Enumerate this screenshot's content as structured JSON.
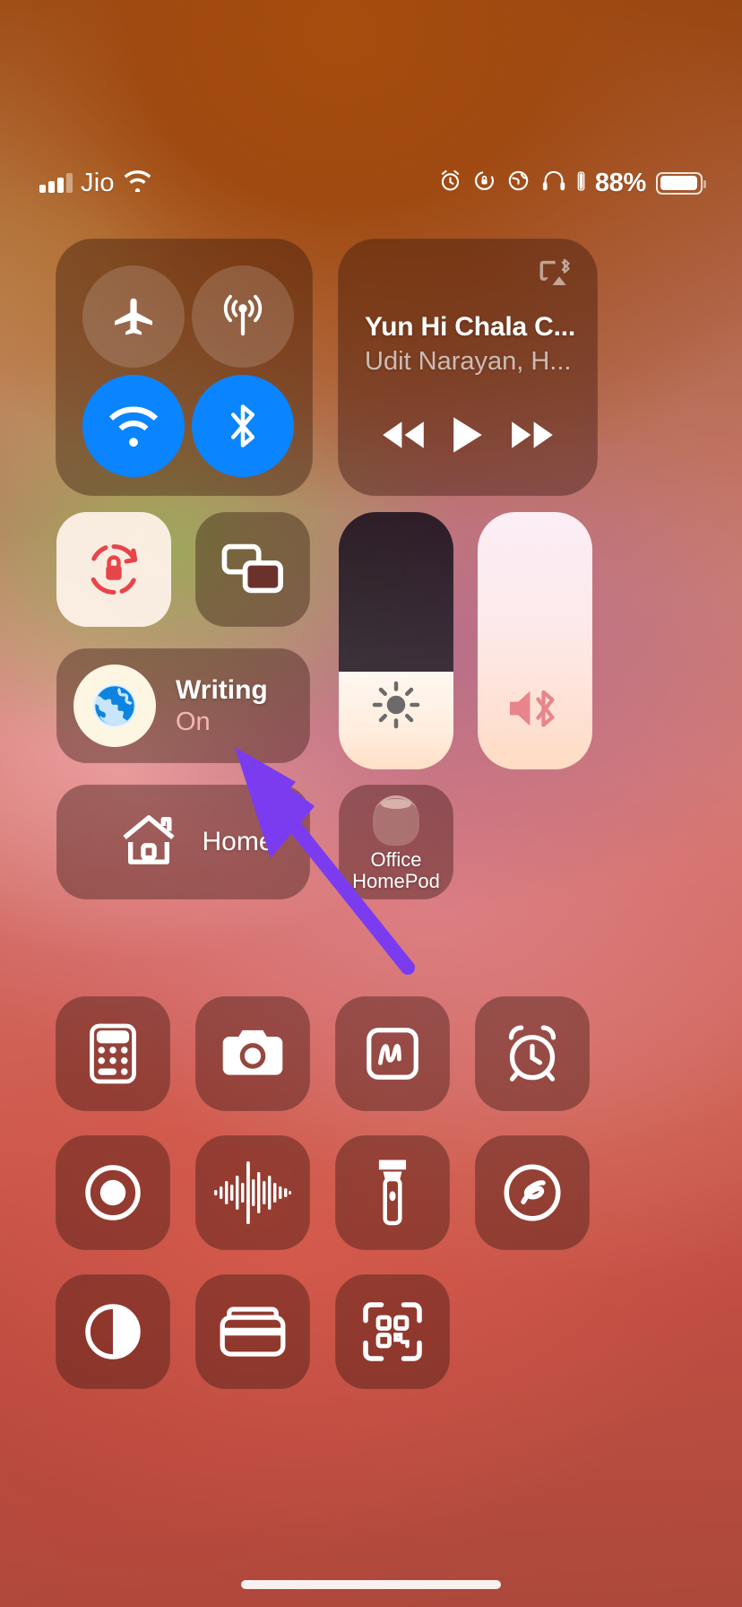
{
  "status_bar": {
    "carrier": "Jio",
    "signal_icon": "cellular-bars-icon",
    "wifi_icon": "wifi-icon",
    "indicators": [
      "alarm-icon",
      "rotation-lock-icon",
      "location-icon",
      "headphones-icon"
    ],
    "battery_percent": "88%",
    "battery_level": 88,
    "battery_icon": "battery-icon"
  },
  "control_center": {
    "connectivity": {
      "name": "connectivity-module",
      "toggles": [
        {
          "name": "airplane-mode",
          "icon": "airplane-icon",
          "state": "off"
        },
        {
          "name": "cellular-data",
          "icon": "cellular-antenna-icon",
          "state": "off"
        },
        {
          "name": "wifi",
          "icon": "wifi-icon",
          "state": "on"
        },
        {
          "name": "bluetooth",
          "icon": "bluetooth-icon",
          "state": "on"
        }
      ]
    },
    "now_playing": {
      "name": "now-playing-module",
      "title": "Yun Hi Chala C...",
      "artist": "Udit Narayan, H...",
      "route_icon": "airplay-bluetooth-icon",
      "controls": [
        {
          "name": "rewind-button",
          "icon": "rewind-icon"
        },
        {
          "name": "play-button",
          "icon": "play-icon"
        },
        {
          "name": "fast-forward-button",
          "icon": "fast-forward-icon"
        }
      ]
    },
    "rotation_lock": {
      "label": "Rotation Lock",
      "icon": "rotation-lock-icon",
      "state": "on"
    },
    "screen_mirroring": {
      "label": "Screen Mirroring",
      "icon": "screen-mirroring-icon",
      "state": "off"
    },
    "focus": {
      "name": "Writing",
      "state": "On",
      "icon": "globe-icon"
    },
    "brightness": {
      "label": "Brightness",
      "icon": "brightness-icon",
      "value": 38
    },
    "volume": {
      "label": "Volume",
      "icon": "speaker-bluetooth-icon",
      "value": 100
    },
    "home": {
      "label": "Home",
      "icon": "home-icon"
    },
    "homepod": {
      "label_line1": "Office",
      "label_line2": "HomePod",
      "icon": "homepod-icon"
    },
    "shortcuts": [
      {
        "label": "Calculator",
        "icon": "calculator-icon"
      },
      {
        "label": "Camera",
        "icon": "camera-icon"
      },
      {
        "label": "Quick Note",
        "icon": "quick-note-icon"
      },
      {
        "label": "Alarm",
        "icon": "alarm-clock-icon"
      },
      {
        "label": "Screen Recording",
        "icon": "screen-record-icon"
      },
      {
        "label": "Voice Memos",
        "icon": "voice-memo-waveform-icon"
      },
      {
        "label": "Flashlight",
        "icon": "flashlight-icon"
      },
      {
        "label": "Shazam",
        "icon": "shazam-icon"
      },
      {
        "label": "Dark Mode",
        "icon": "dark-mode-icon"
      },
      {
        "label": "Wallet",
        "icon": "wallet-icon"
      },
      {
        "label": "Code Scanner",
        "icon": "qr-scanner-icon"
      }
    ]
  },
  "annotation": {
    "arrow_color": "#7B3CF0",
    "points_at": "focus-tile-writing"
  },
  "home_indicator": {
    "name": "home-indicator"
  }
}
